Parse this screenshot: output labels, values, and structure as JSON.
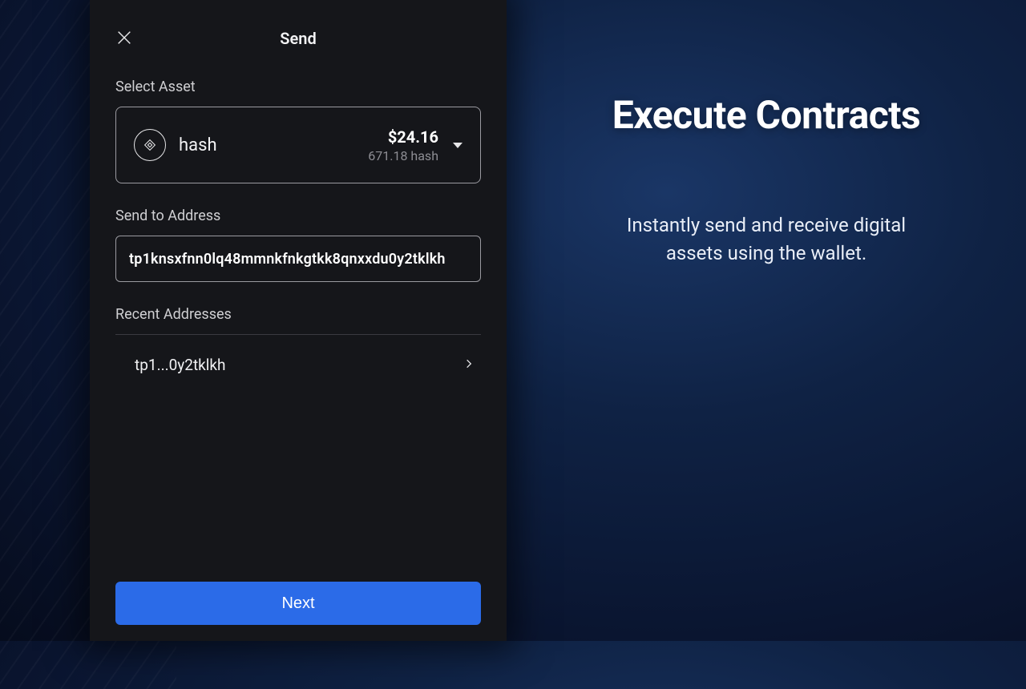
{
  "panel": {
    "title": "Send",
    "select_asset_label": "Select Asset",
    "asset": {
      "name": "hash",
      "usd": "$24.16",
      "balance": "671.18 hash"
    },
    "send_to_label": "Send to Address",
    "address_value": "tp1knsxfnn0lq48mmnkfnkgtkk8qnxxdu0y2tklkh",
    "recent_label": "Recent Addresses",
    "recent": [
      {
        "short": "tp1...0y2tklkh"
      }
    ],
    "next_label": "Next"
  },
  "promo": {
    "title": "Execute Contracts",
    "subtitle": "Instantly send and receive digital assets using the wallet."
  },
  "colors": {
    "accent": "#2b6be8",
    "panel_bg": "#15161a"
  }
}
